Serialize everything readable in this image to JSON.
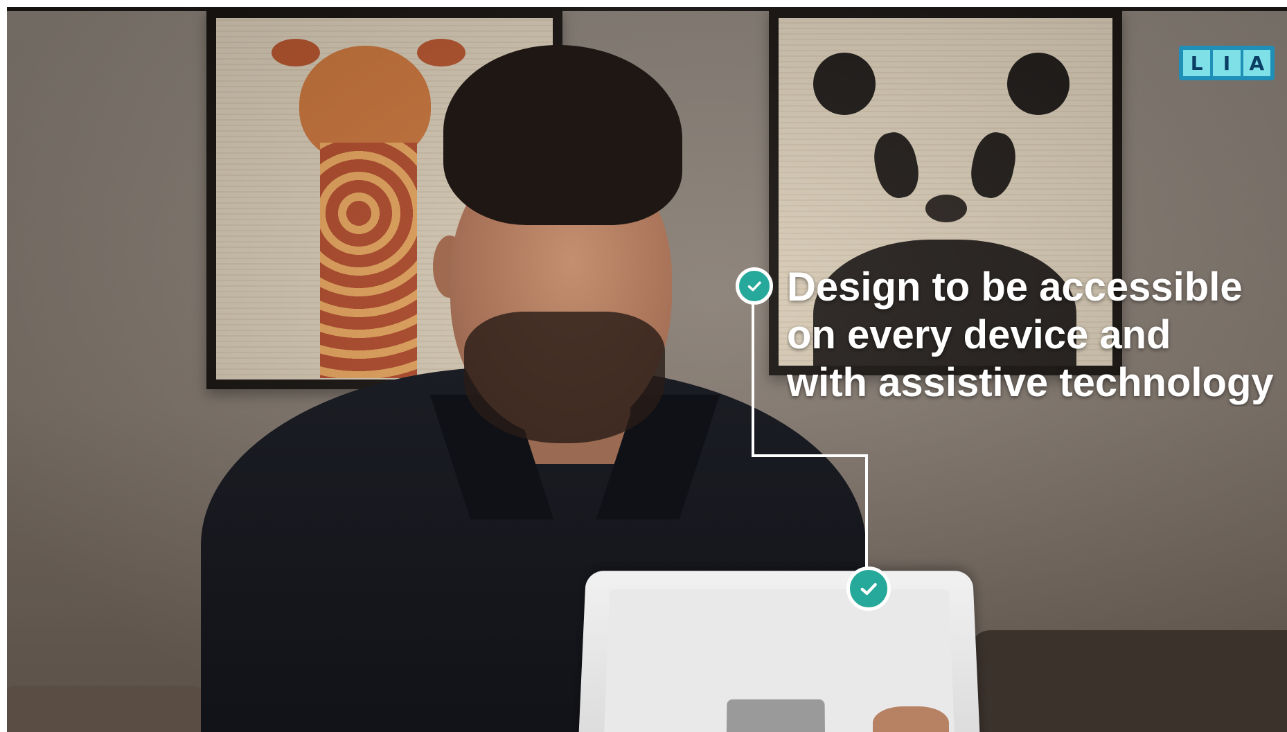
{
  "scene": {
    "caption_lines": [
      "Design to be accessible",
      "on every device and",
      "with assistive technology"
    ],
    "logo_letters": [
      "L",
      "I",
      "A"
    ]
  },
  "colors": {
    "accent_teal": "#26a99a",
    "logo_blue": "#1f8fb8",
    "logo_tile": "#7fe0e8",
    "caption_text": "#ffffff"
  },
  "icons": {
    "callout_marker": "check-circle-icon",
    "device_marker": "check-circle-icon"
  }
}
